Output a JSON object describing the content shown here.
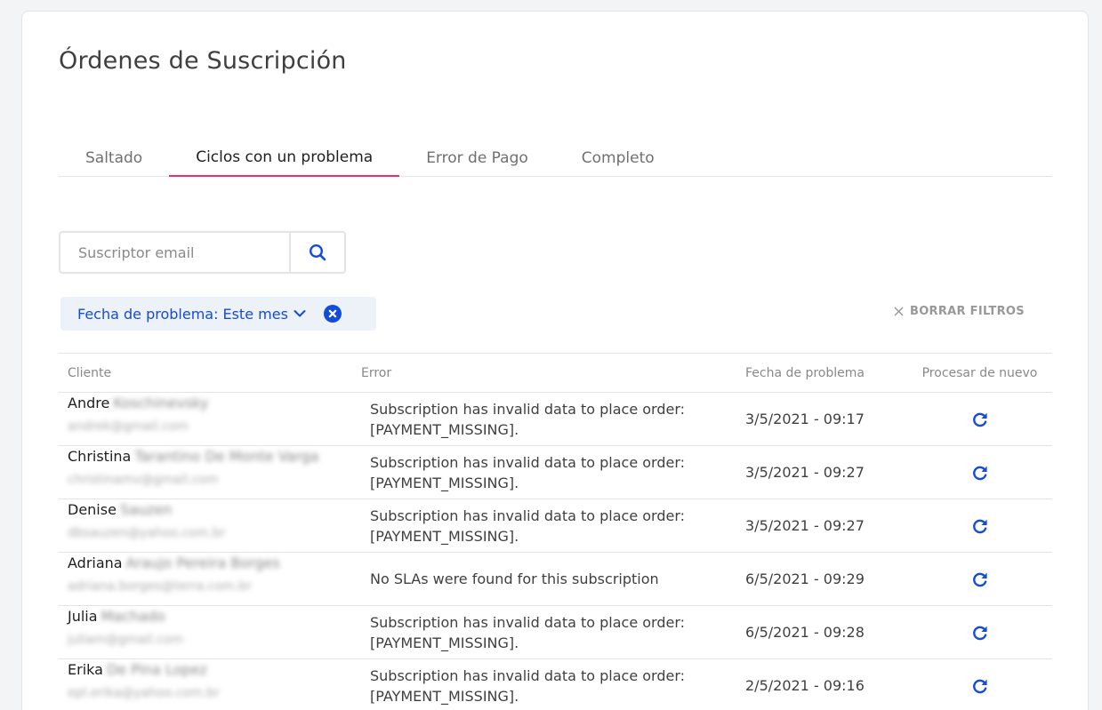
{
  "page": {
    "title": "Órdenes de Suscripción"
  },
  "tabs": [
    {
      "label": "Saltado",
      "active": false
    },
    {
      "label": "Ciclos con un problema",
      "active": true
    },
    {
      "label": "Error de Pago",
      "active": false
    },
    {
      "label": "Completo",
      "active": false
    }
  ],
  "search": {
    "placeholder": "Suscriptor email",
    "value": "",
    "button_icon": "search-icon"
  },
  "filter": {
    "label": "Fecha de problema:",
    "value": "Este mes",
    "chevron_icon": "chevron-down-icon",
    "remove_icon": "close-circle-icon"
  },
  "clear_filters": {
    "label": "BORRAR FILTROS",
    "icon": "close-icon"
  },
  "table": {
    "headers": [
      "Cliente",
      "Error",
      "Fecha de problema",
      "Procesar de nuevo"
    ],
    "rows": [
      {
        "first": "Andre",
        "last": "Koschinevsky",
        "email": "andrek@gmail.com",
        "error": "Subscription has invalid data to place order: [PAYMENT_MISSING].",
        "date": "3/5/2021 - 09:17"
      },
      {
        "first": "Christina",
        "last": "Tarantino De Monte Varga",
        "email": "christinamv@gmail.com",
        "error": "Subscription has invalid data to place order: [PAYMENT_MISSING].",
        "date": "3/5/2021 - 09:27"
      },
      {
        "first": "Denise",
        "last": "Sauzen",
        "email": "dbsauzen@yahoo.com.br",
        "error": "Subscription has invalid data to place order: [PAYMENT_MISSING].",
        "date": "3/5/2021 - 09:27"
      },
      {
        "first": "Adriana",
        "last": "Araujo Pereira Borges",
        "email": "adriana.borges@terra.com.br",
        "error": "No SLAs were found for this subscription",
        "date": "6/5/2021 - 09:29"
      },
      {
        "first": "Julia",
        "last": "Machado",
        "email": "juliam@gmail.com",
        "error": "Subscription has invalid data to place order: [PAYMENT_MISSING].",
        "date": "6/5/2021 - 09:28"
      },
      {
        "first": "Erika",
        "last": "De Pina Lopez",
        "email": "epl.erika@yahoo.com.br",
        "error": "Subscription has invalid data to place order: [PAYMENT_MISSING].",
        "date": "2/5/2021 - 09:16"
      }
    ],
    "action_icon": "refresh-icon"
  },
  "colors": {
    "accent_blue": "#134cd8",
    "tab_underline": "#e8306e",
    "chip_bg": "#edf1f8"
  }
}
